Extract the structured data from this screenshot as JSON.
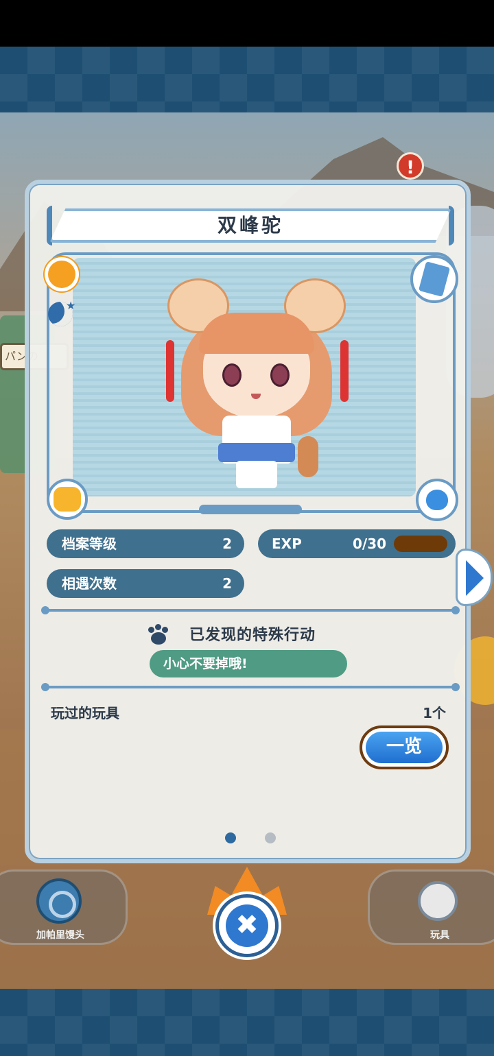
{
  "title": "双峰驼",
  "background": {
    "cart_sign": "パンの"
  },
  "stats": {
    "level_label": "档案等级",
    "level_value": "2",
    "exp_label": "EXP",
    "exp_value": "0/30",
    "exp_progress": 0,
    "encounter_label": "相遇次数",
    "encounter_value": "2"
  },
  "special": {
    "title": "已发现的特殊行动",
    "behavior": "小心不要掉哦!"
  },
  "toys": {
    "label": "玩过的玩具",
    "count": "1个",
    "list_button": "一览"
  },
  "pagination": {
    "current": 1,
    "total": 2
  },
  "bottom_bar": {
    "left_label": "加帕里馒头",
    "right_label": "玩具",
    "close_symbol": "✖"
  },
  "alert_symbol": "!",
  "colors": {
    "primary_blue": "#2f78d0",
    "pill_bg": "#3f708e",
    "behavior_green": "#4f9b84",
    "exp_bar": "#6e3a08",
    "frame_blue": "#6a9bc4"
  },
  "icons": {
    "day": "sun-icon",
    "night": "moon-icon",
    "food": "japari-bun-icon",
    "book": "book-icon",
    "paw": "paw-icon"
  }
}
